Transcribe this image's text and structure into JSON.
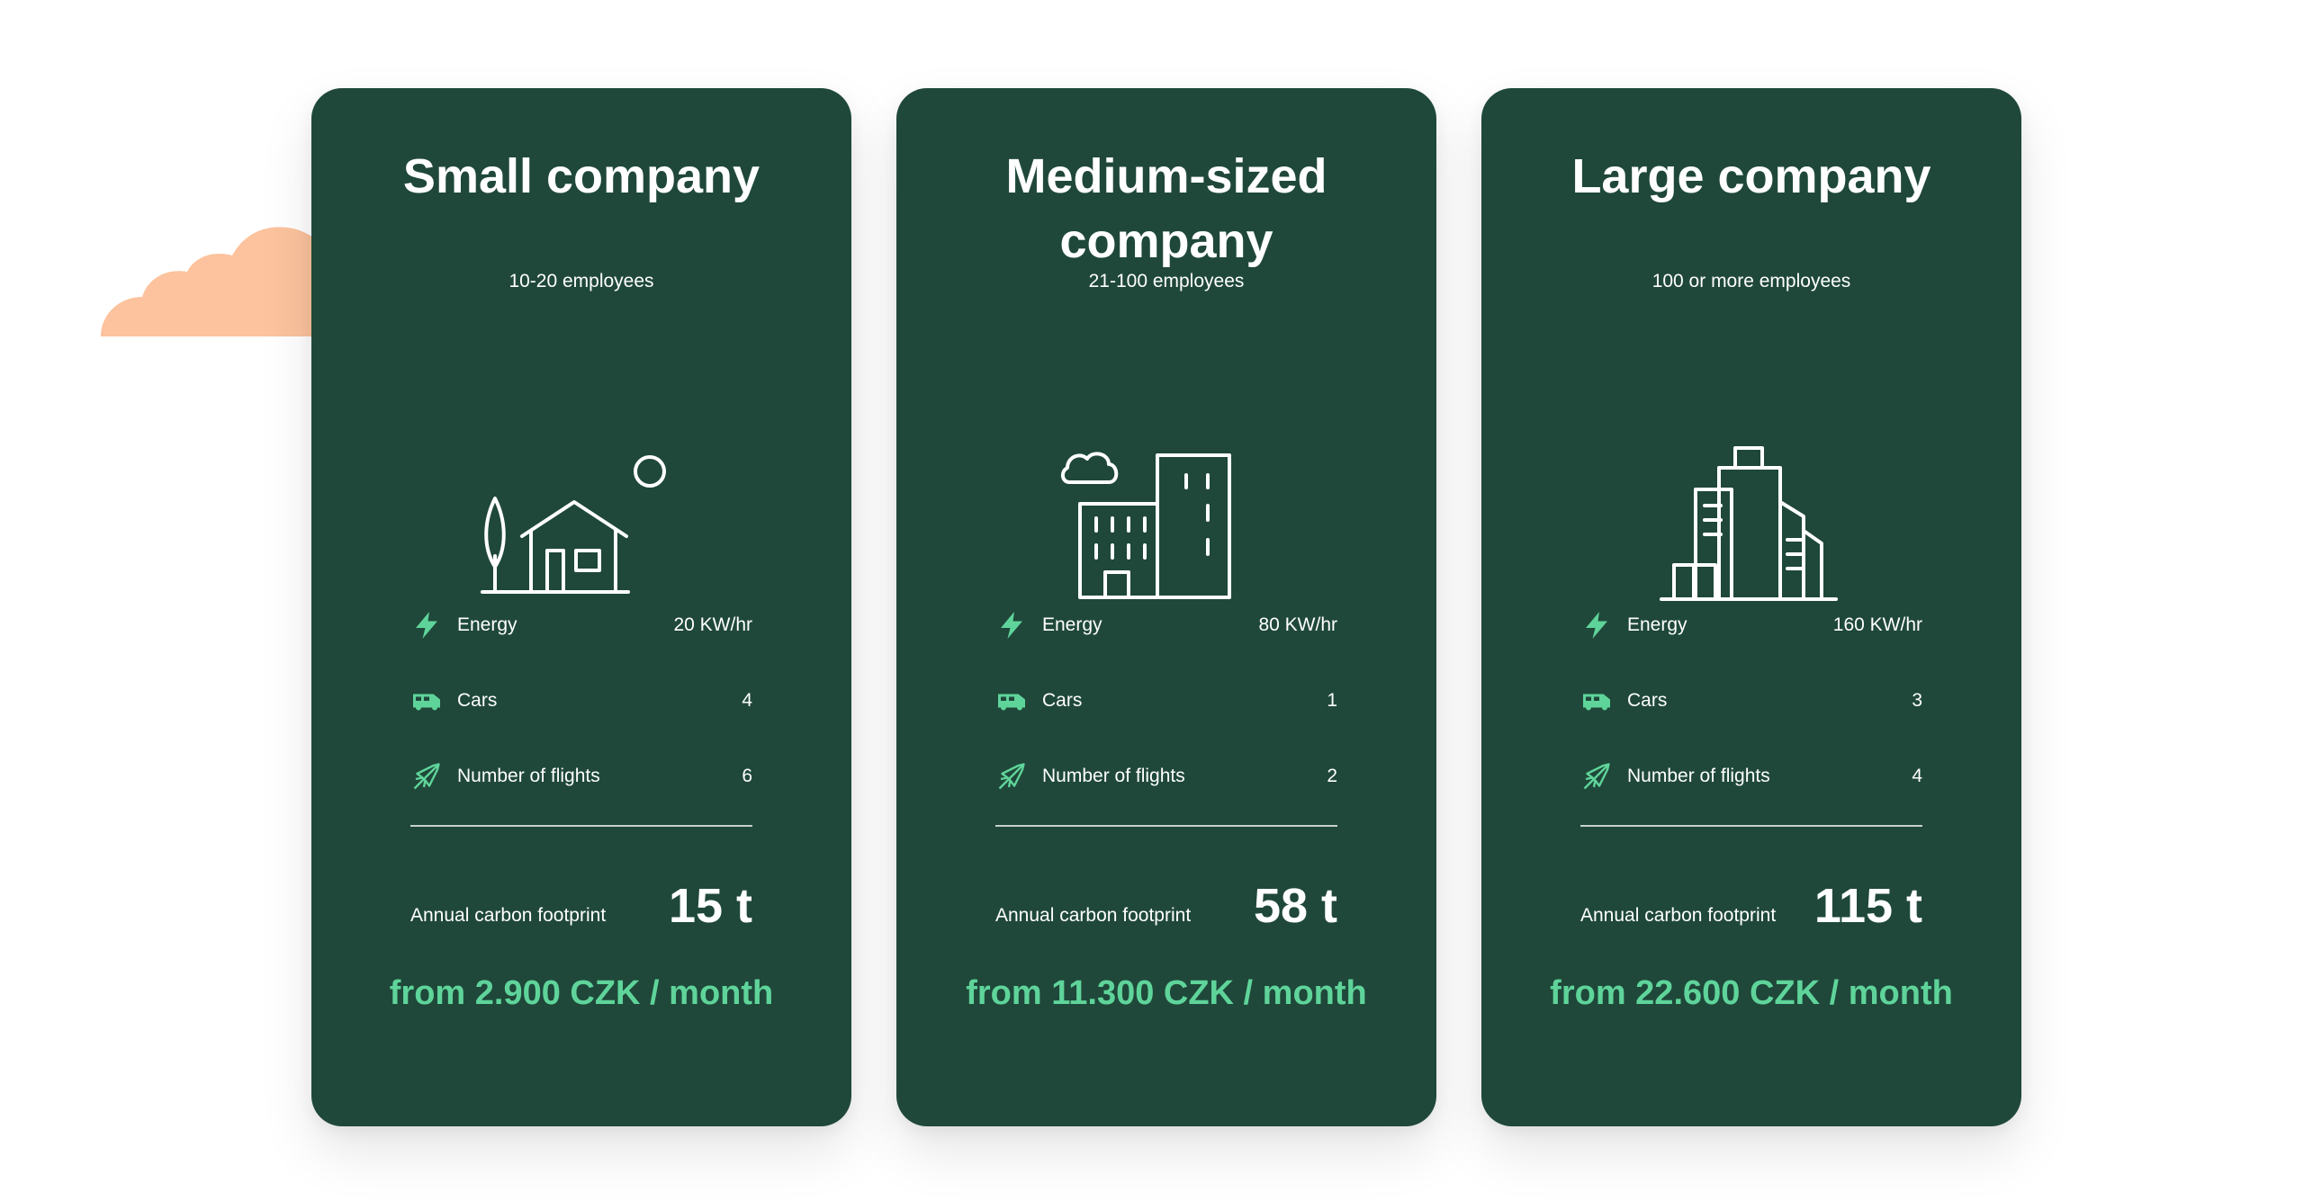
{
  "colors": {
    "card_bg": "#1f483a",
    "accent": "#5fd49a",
    "cloud": "#fcc39e"
  },
  "cards": [
    {
      "title": "Small company",
      "subtitle": "10-20 employees",
      "illustration": "house-tree-sun-icon",
      "metrics": [
        {
          "icon": "lightning-icon",
          "label": "Energy",
          "value": "20 KW/hr"
        },
        {
          "icon": "van-icon",
          "label": "Cars",
          "value": "4"
        },
        {
          "icon": "airplane-icon",
          "label": "Number of flights",
          "value": "6"
        }
      ],
      "footprint_label": "Annual carbon footprint",
      "footprint_value": "15 t",
      "price": "from 2.900 CZK / month"
    },
    {
      "title": "Medium-sized company",
      "subtitle": "21-100 employees",
      "illustration": "buildings-cloud-icon",
      "metrics": [
        {
          "icon": "lightning-icon",
          "label": "Energy",
          "value": "80 KW/hr"
        },
        {
          "icon": "van-icon",
          "label": "Cars",
          "value": "1"
        },
        {
          "icon": "airplane-icon",
          "label": "Number of flights",
          "value": "2"
        }
      ],
      "footprint_label": "Annual carbon footprint",
      "footprint_value": "58 t",
      "price": "from 11.300 CZK / month"
    },
    {
      "title": "Large company",
      "subtitle": "100 or more employees",
      "illustration": "skyscrapers-icon",
      "metrics": [
        {
          "icon": "lightning-icon",
          "label": "Energy",
          "value": "160 KW/hr"
        },
        {
          "icon": "van-icon",
          "label": "Cars",
          "value": "3"
        },
        {
          "icon": "airplane-icon",
          "label": "Number of flights",
          "value": "4"
        }
      ],
      "footprint_label": "Annual carbon footprint",
      "footprint_value": "115 t",
      "price": "from 22.600 CZK / month"
    }
  ]
}
